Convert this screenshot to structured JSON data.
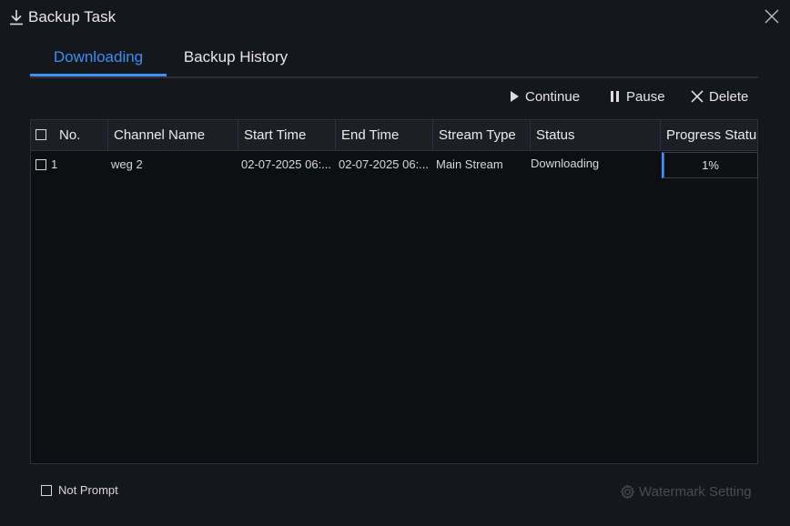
{
  "window": {
    "title": "Backup Task"
  },
  "tabs": [
    {
      "label": "Downloading",
      "active": true
    },
    {
      "label": "Backup History",
      "active": false
    }
  ],
  "toolbar": {
    "continue_label": "Continue",
    "pause_label": "Pause",
    "delete_label": "Delete"
  },
  "table": {
    "columns": [
      "No.",
      "Channel Name",
      "Start Time",
      "End Time",
      "Stream Type",
      "Status",
      "Progress Statu"
    ],
    "rows": [
      {
        "no": "1",
        "channel": "weg 2",
        "start": "02-07-2025 06:...",
        "end": "02-07-2025 06:...",
        "stream": "Main Stream",
        "status": "Downloading",
        "progress_text": "1%",
        "progress_value": 0.01
      }
    ]
  },
  "footer": {
    "not_prompt_label": "Not Prompt",
    "watermark_label": "Watermark Setting"
  },
  "colors": {
    "accent": "#3d8ff0",
    "background": "#15171c"
  }
}
